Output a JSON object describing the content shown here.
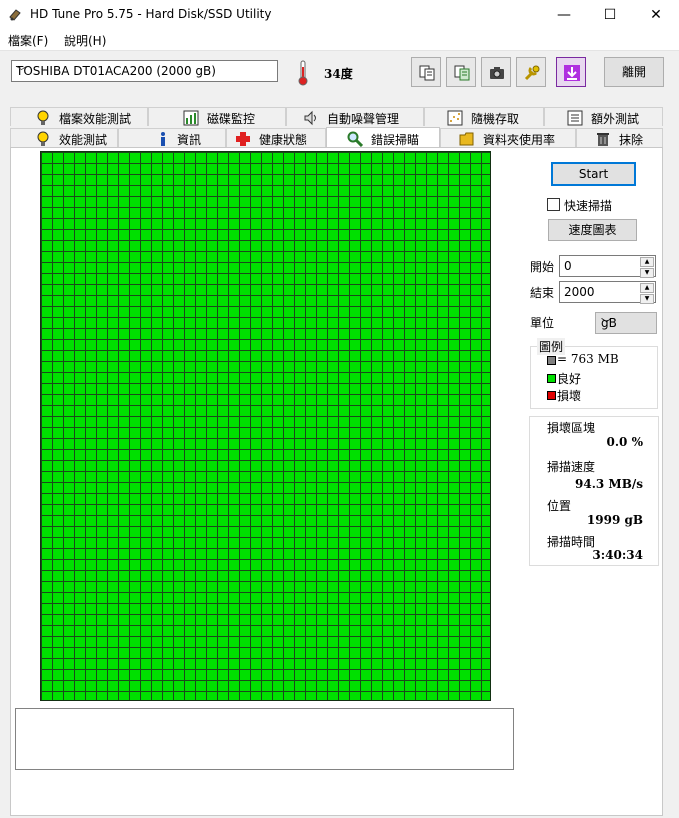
{
  "window": {
    "title": "HD Tune Pro 5.75 - Hard Disk/SSD Utility",
    "minimize": "—",
    "maximize": "☐",
    "close": "✕"
  },
  "menu": {
    "items": [
      "檔案(F)",
      "說明(H)"
    ]
  },
  "toolbar": {
    "drive": "TOSHIBA DT01ACA200 (2000 gB)",
    "temperature": "34度",
    "exit_label": "離開"
  },
  "tabs_top": [
    "檔案效能測試",
    "磁碟監控",
    "自動噪聲管理",
    "隨機存取",
    "額外測試"
  ],
  "tabs_bottom": [
    "效能測試",
    "資訊",
    "健康狀態",
    "錯誤掃瞄",
    "資料夾使用率",
    "抹除"
  ],
  "active_tab": "錯誤掃瞄",
  "scan": {
    "start_label": "Start",
    "quick_scan_label": "快速掃描",
    "quick_scan_checked": false,
    "speed_map_label": "速度圖表",
    "start_field_label": "開始",
    "start_value": "0",
    "end_field_label": "結束",
    "end_value": "2000",
    "unit_label": "單位",
    "unit_value": "gB",
    "grid_state": "all-good"
  },
  "legend": {
    "title": "圖例",
    "block_size": "= 763 MB",
    "good": "良好",
    "damaged": "損壞",
    "colors": {
      "block": "#808080",
      "good": "#00e000",
      "damaged": "#e00000"
    }
  },
  "stats": {
    "damaged_blocks_label": "損壞區塊",
    "damaged_blocks_value": "0.0 %",
    "scan_speed_label": "掃描速度",
    "scan_speed_value": "94.3 MB/s",
    "position_label": "位置",
    "position_value": "1999 gB",
    "scan_time_label": "掃描時間",
    "scan_time_value": "3:40:34"
  },
  "log": {
    "text": ""
  }
}
